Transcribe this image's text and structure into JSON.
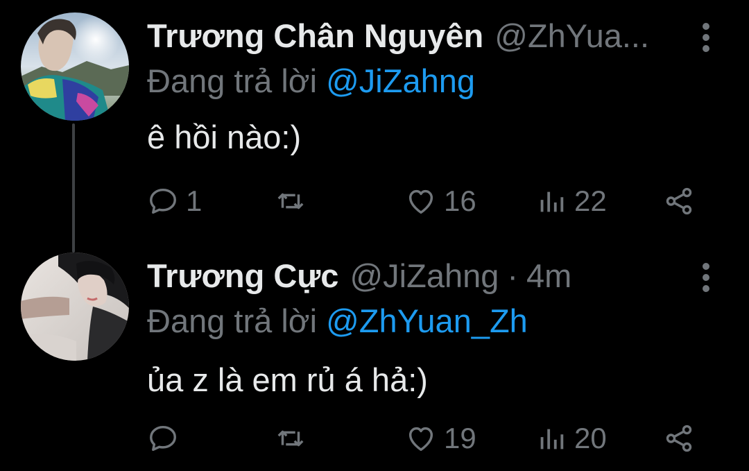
{
  "tweets": [
    {
      "display_name": "Trương Chân Nguyên",
      "handle": "@ZhYua...",
      "replying_prefix": "Đang trả lời",
      "replying_to": "@JiZahng",
      "content": "ê hồi nào:)",
      "reply_count": "1",
      "retweet_count": "",
      "like_count": "16",
      "view_count": "22"
    },
    {
      "display_name": "Trương Cực",
      "handle": "@JiZahng",
      "separator": "·",
      "time": "4m",
      "replying_prefix": "Đang trả lời",
      "replying_to": "@ZhYuan_Zh",
      "content": "ủa z là em rủ á hả:)",
      "reply_count": "",
      "retweet_count": "",
      "like_count": "19",
      "view_count": "20"
    }
  ],
  "colors": {
    "background": "#000000",
    "primary_text": "#e7e9ea",
    "secondary_text": "#71767b",
    "accent": "#1d9bf0",
    "thread_line": "#3e4144"
  },
  "icons": [
    "more-vertical-icon",
    "reply-icon",
    "retweet-icon",
    "like-icon",
    "views-icon",
    "share-icon"
  ]
}
